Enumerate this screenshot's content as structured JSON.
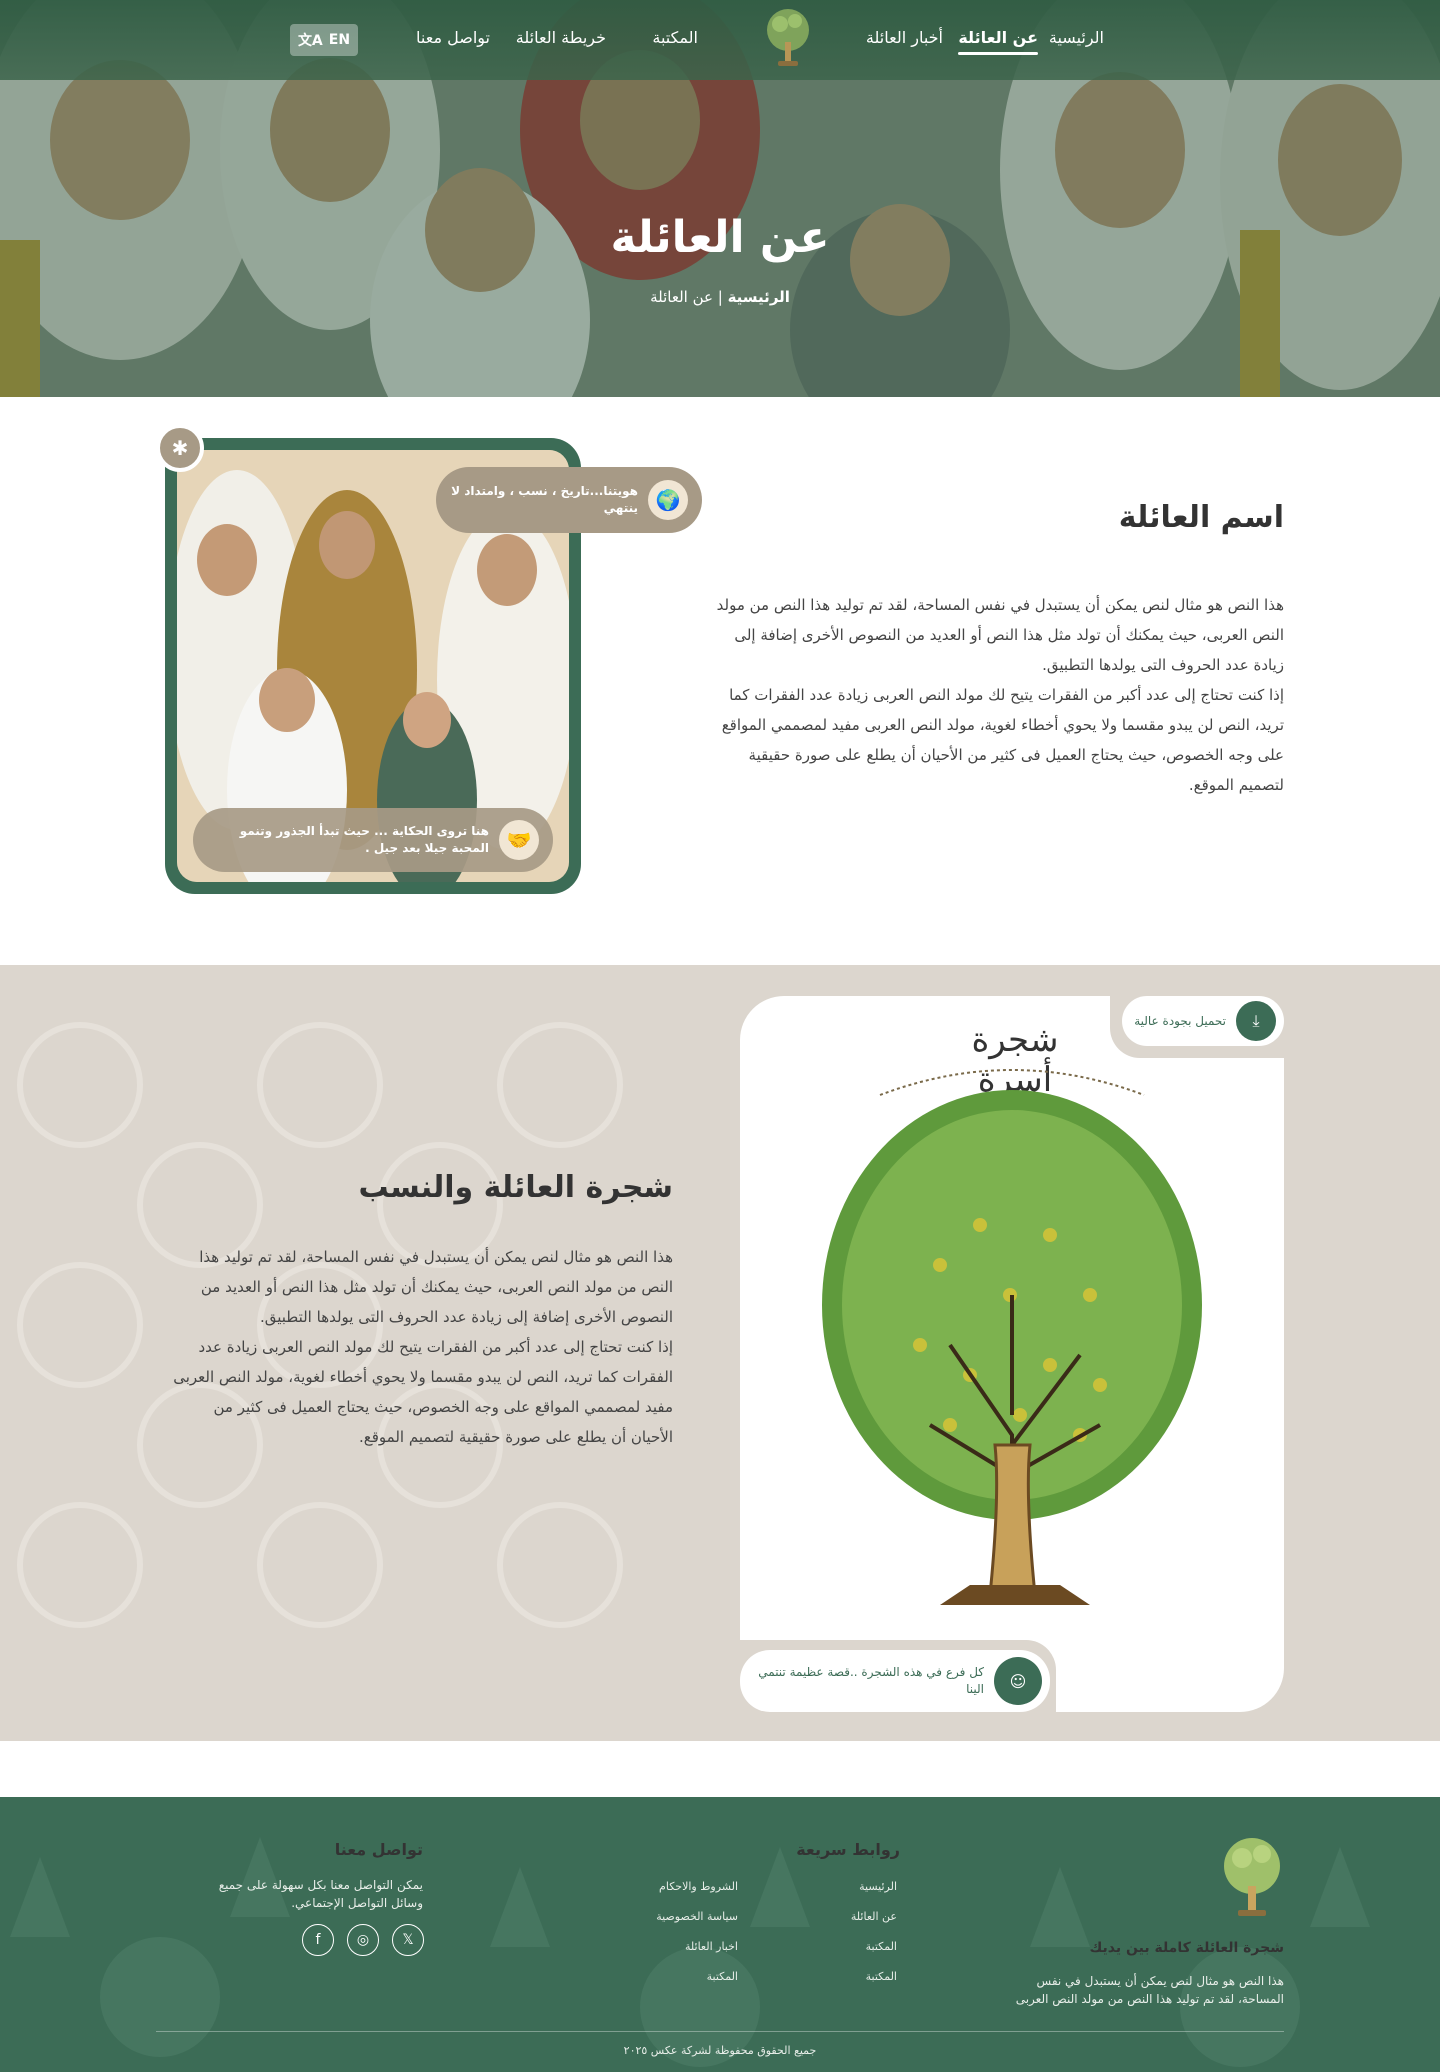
{
  "colors": {
    "brand_green": "#3c6c56",
    "taupe": "#a79a86",
    "section_bg": "#dcd6ce"
  },
  "nav": {
    "items": [
      {
        "label": "الرئيسية"
      },
      {
        "label": "عن العائلة",
        "active": true
      },
      {
        "label": "أخبار العائلة"
      },
      {
        "label": "المكتبة"
      },
      {
        "label": "خريطة العائلة"
      },
      {
        "label": "تواصل معنا"
      }
    ],
    "lang_label": "EN",
    "lang_icon": "translate-icon",
    "logo_icon": "family-tree-logo"
  },
  "hero": {
    "title": "عن العائلة",
    "breadcrumb_home": "الرئيسية",
    "breadcrumb_separator": "|",
    "breadcrumb_current": "عن العائلة"
  },
  "about": {
    "title": "اسم العائلة",
    "paragraph1": "هذا النص هو مثال لنص يمكن أن يستبدل في نفس المساحة، لقد تم توليد هذا النص من مولد النص العربى، حيث يمكنك أن تولد مثل هذا النص أو العديد من النصوص الأخرى إضافة إلى زيادة عدد الحروف التى يولدها التطبيق.",
    "paragraph2": "إذا كنت تحتاج إلى عدد أكبر من الفقرات يتيح لك مولد النص العربى زيادة عدد الفقرات كما تريد، النص لن يبدو مقسما ولا يحوي أخطاء لغوية، مولد النص العربى مفيد لمصممي المواقع على وجه الخصوص، حيث يحتاج العميل فى كثير من الأحيان أن يطلع على صورة حقيقية لتصميم الموقع.",
    "badge_top": "هويتنا...تاريخ ، نسب ، وامتداد لا ينتهي",
    "badge_bottom": "هنا تروى الحكاية ... حيث تبدأ الجذور وتنمو المحبة جيلا بعد جيل ."
  },
  "tree": {
    "title": "شجرة العائلة والنسب",
    "paragraph1": "هذا النص هو مثال لنص يمكن أن يستبدل في نفس المساحة، لقد تم توليد هذا النص من مولد النص العربى، حيث يمكنك أن تولد مثل هذا النص أو العديد من النصوص الأخرى إضافة إلى زيادة عدد الحروف التى يولدها التطبيق.",
    "paragraph2": "إذا كنت تحتاج إلى عدد أكبر من الفقرات يتيح لك مولد النص العربى زيادة عدد الفقرات كما تريد، النص لن يبدو مقسما ولا يحوي أخطاء لغوية، مولد النص العربى مفيد لمصممي المواقع على وجه الخصوص، حيث يحتاج العميل فى كثير من الأحيان أن يطلع على صورة حقيقية لتصميم الموقع.",
    "download_label": "تحميل بجودة عالية",
    "caption": "كل فرع في هذه الشجرة ..قصة عظيمة تنتمي الينا",
    "calligraphy": "شجرة أسرة الشثري"
  },
  "footer": {
    "brand": "شجرة العائلة كاملة بين يديك",
    "description": "هذا النص هو مثال لنص يمكن أن يستبدل في نفس المساحة، لقد تم توليد هذا النص من مولد النص العربى",
    "quick_links_title": "روابط سريعة",
    "links_col1": [
      "الرئيسية",
      "عن العائلة",
      "المكتبة",
      "المكتبة"
    ],
    "links_col2": [
      "الشروط والاحكام",
      "سياسة الخصوصية",
      "اخبار العائلة",
      "المكتبة"
    ],
    "contact_title": "تواصل معنا",
    "contact_text": "يمكن التواصل معنا بكل سهولة على جميع وسائل التواصل الإجتماعي.",
    "social_icons": [
      "x-icon",
      "instagram-icon",
      "facebook-icon"
    ],
    "copyright": "جميع الحقوق محفوظة لشركة عكس ٢٠٢٥"
  }
}
